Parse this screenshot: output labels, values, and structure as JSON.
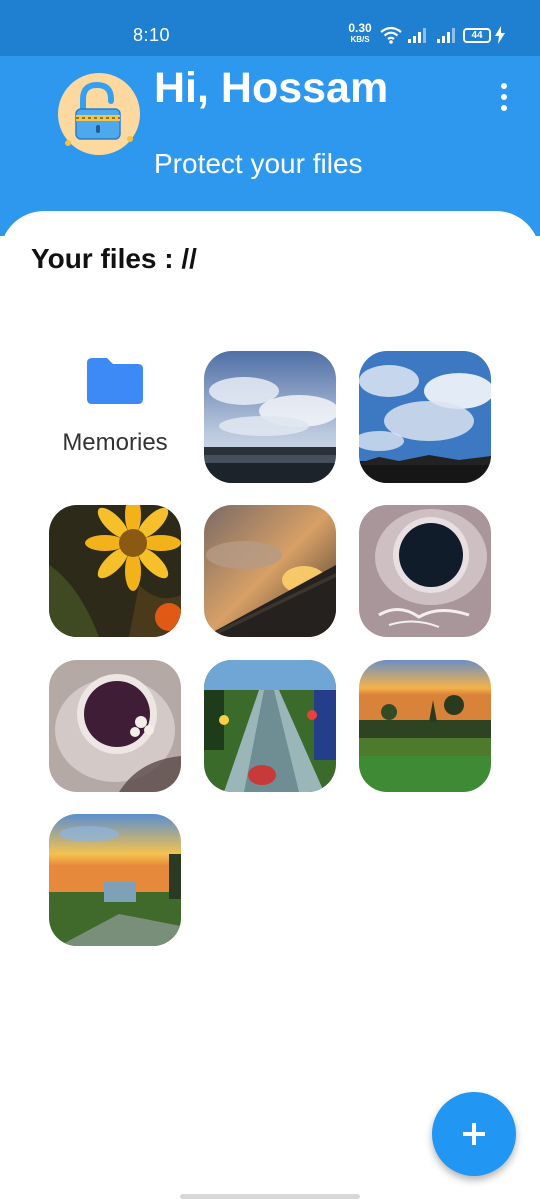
{
  "status_bar": {
    "time": "8:10",
    "net_speed_value": "0.30",
    "net_speed_unit": "KB/S",
    "battery": "44"
  },
  "header": {
    "greeting": "Hi, Hossam",
    "subtitle": "Protect your files",
    "avatar_icon": "unlocked-padlock-icon",
    "menu_icon": "more-vert-icon",
    "color": "#2e98ee"
  },
  "files": {
    "title": "Your files : //",
    "folder": {
      "label": "Memories",
      "icon": "folder-icon",
      "color": "#3d8af7"
    },
    "images": [
      {
        "name": "cloudy-sky-over-water"
      },
      {
        "name": "clouds-blue-sky"
      },
      {
        "name": "yellow-daisy"
      },
      {
        "name": "golden-sunset-clouds"
      },
      {
        "name": "coffee-cup-arabic-text"
      },
      {
        "name": "tea-cup-flower"
      },
      {
        "name": "garden-path-lanterns"
      },
      {
        "name": "park-at-sunset"
      },
      {
        "name": "sunset-field-building"
      }
    ]
  },
  "fab": {
    "icon": "plus-icon",
    "color": "#2196f3"
  }
}
